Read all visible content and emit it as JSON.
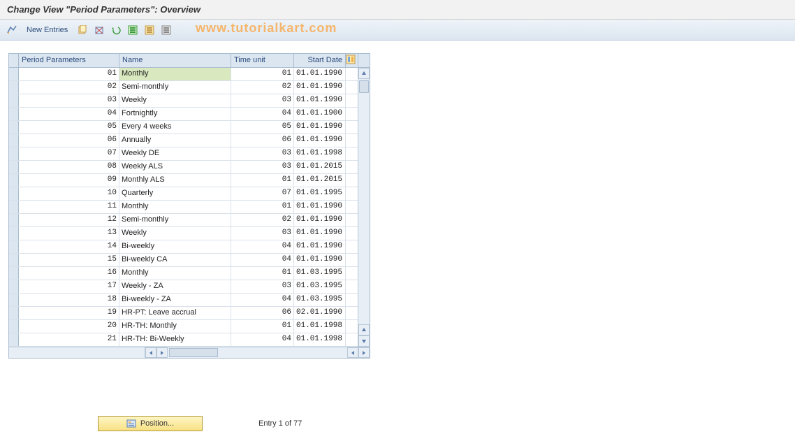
{
  "title": "Change View \"Period Parameters\": Overview",
  "toolbar": {
    "new_entries_label": "New Entries"
  },
  "watermark": "www.tutorialkart.com",
  "columns": {
    "period_param": "Period Parameters",
    "name": "Name",
    "time_unit": "Time unit",
    "start_date": "Start Date"
  },
  "rows": [
    {
      "pp": "01",
      "name": "Monthly",
      "tu": "01",
      "sd": "01.01.1990",
      "selected": true
    },
    {
      "pp": "02",
      "name": "Semi-monthly",
      "tu": "02",
      "sd": "01.01.1990"
    },
    {
      "pp": "03",
      "name": "Weekly",
      "tu": "03",
      "sd": "01.01.1990"
    },
    {
      "pp": "04",
      "name": "Fortnightly",
      "tu": "04",
      "sd": "01.01.1900"
    },
    {
      "pp": "05",
      "name": "Every 4 weeks",
      "tu": "05",
      "sd": "01.01.1990"
    },
    {
      "pp": "06",
      "name": "Annually",
      "tu": "06",
      "sd": "01.01.1990"
    },
    {
      "pp": "07",
      "name": "Weekly  DE",
      "tu": "03",
      "sd": "01.01.1998"
    },
    {
      "pp": "08",
      "name": "Weekly ALS",
      "tu": "03",
      "sd": "01.01.2015"
    },
    {
      "pp": "09",
      "name": "Monthly ALS",
      "tu": "01",
      "sd": "01.01.2015"
    },
    {
      "pp": "10",
      "name": "Quarterly",
      "tu": "07",
      "sd": "01.01.1995"
    },
    {
      "pp": "11",
      "name": "Monthly",
      "tu": "01",
      "sd": "01.01.1990"
    },
    {
      "pp": "12",
      "name": "Semi-monthly",
      "tu": "02",
      "sd": "01.01.1990"
    },
    {
      "pp": "13",
      "name": "Weekly",
      "tu": "03",
      "sd": "01.01.1990"
    },
    {
      "pp": "14",
      "name": "Bi-weekly",
      "tu": "04",
      "sd": "01.01.1990"
    },
    {
      "pp": "15",
      "name": "Bi-weekly CA",
      "tu": "04",
      "sd": "01.01.1990"
    },
    {
      "pp": "16",
      "name": "Monthly",
      "tu": "01",
      "sd": "01.03.1995"
    },
    {
      "pp": "17",
      "name": "Weekly - ZA",
      "tu": "03",
      "sd": "01.03.1995"
    },
    {
      "pp": "18",
      "name": "Bi-weekly - ZA",
      "tu": "04",
      "sd": "01.03.1995"
    },
    {
      "pp": "19",
      "name": "HR-PT: Leave accrual",
      "tu": "06",
      "sd": "02.01.1990"
    },
    {
      "pp": "20",
      "name": "HR-TH: Monthly",
      "tu": "01",
      "sd": "01.01.1998"
    },
    {
      "pp": "21",
      "name": "HR-TH: Bi-Weekly",
      "tu": "04",
      "sd": "01.01.1998"
    }
  ],
  "footer": {
    "position_label": "Position...",
    "entry_text": "Entry 1 of 77"
  }
}
